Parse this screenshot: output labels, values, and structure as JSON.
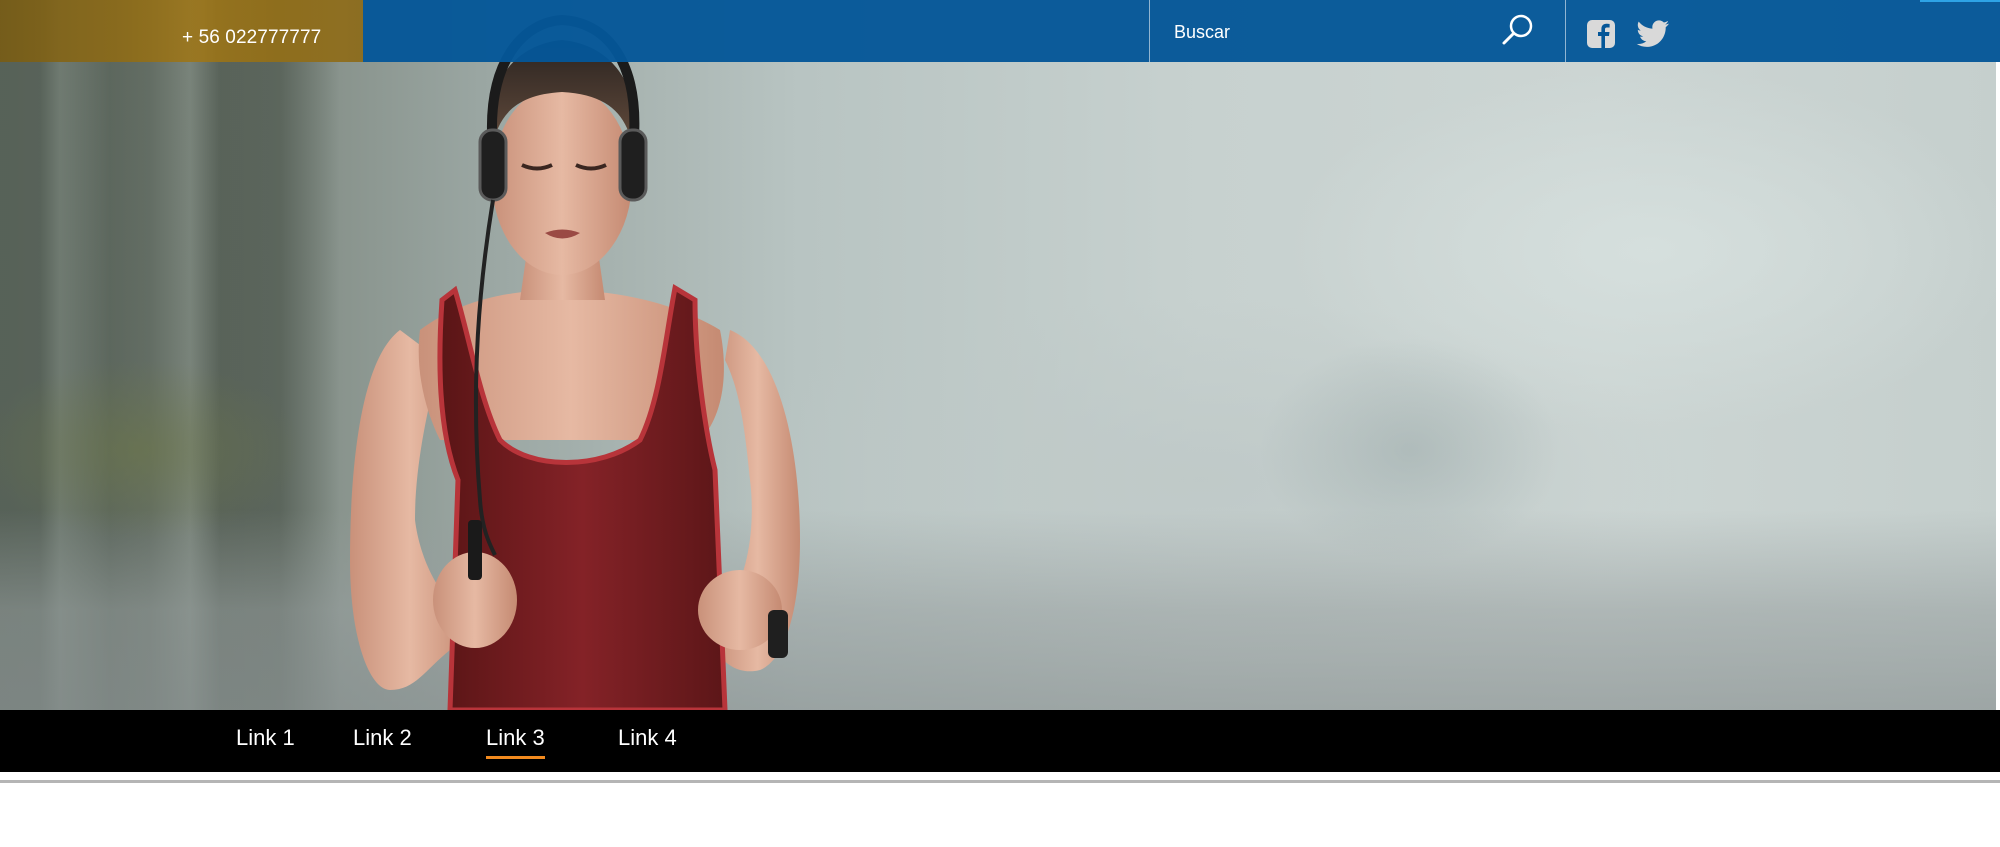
{
  "header": {
    "phone": "+ 56 022777777",
    "search": {
      "placeholder": "Buscar"
    },
    "social": [
      {
        "name": "facebook",
        "icon": "facebook-icon"
      },
      {
        "name": "twitter",
        "icon": "twitter-icon"
      }
    ]
  },
  "hero": {
    "image": "woman-running-with-headphones"
  },
  "nav": {
    "links": [
      {
        "label": "Link 1",
        "active": false
      },
      {
        "label": "Link 2",
        "active": false
      },
      {
        "label": "Link 3",
        "active": true
      },
      {
        "label": "Link 4",
        "active": false
      }
    ]
  },
  "colors": {
    "top_bar_blue": "#045698",
    "phone_box_gold": "#8f6a14",
    "nav_background": "#000000",
    "active_underline": "#f28a1e"
  }
}
